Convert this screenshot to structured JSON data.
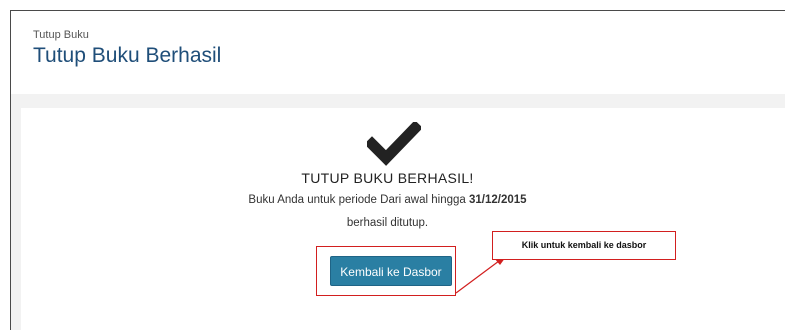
{
  "header": {
    "breadcrumb": "Tutup Buku",
    "title": "Tutup Buku Berhasil"
  },
  "result": {
    "icon": "checkmark-icon",
    "heading": "TUTUP BUKU BERHASIL!",
    "message_prefix": "Buku Anda untuk periode Dari awal hingga",
    "message_date": "31/12/2015",
    "message_suffix": "berhasil ditutup."
  },
  "actions": {
    "dashboard_label": "Kembali ke Dasbor"
  },
  "annotation": {
    "callout_text": "Klik untuk kembali ke dasbor",
    "color": "#d21f1f"
  },
  "colors": {
    "title": "#1f4e79",
    "button": "#2a7fa3"
  }
}
